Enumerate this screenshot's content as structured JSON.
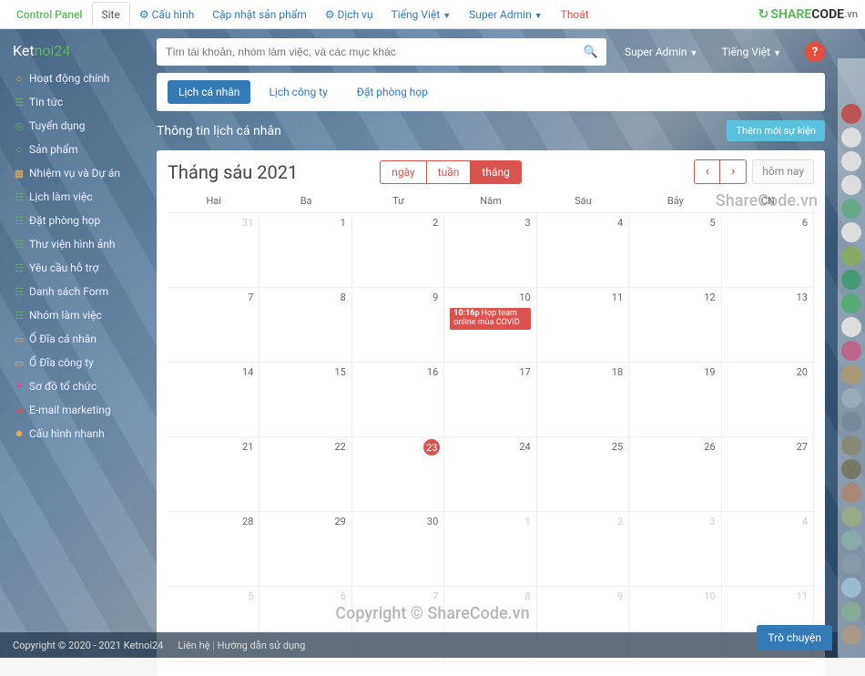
{
  "topnav": {
    "control_panel": "Control Panel",
    "site": "Site",
    "cauhinh": "Cấu hình",
    "capnhat": "Cập nhật sản phẩm",
    "dichvu": "Dịch vụ",
    "tiengviet": "Tiếng Việt",
    "superadmin": "Super Admin",
    "thoat": "Thoát"
  },
  "brand": {
    "ket": "Ket",
    "noi24": "noi24"
  },
  "sidebar": [
    {
      "icon": "○",
      "cls": "icn-orange",
      "label": "Hoạt động chính"
    },
    {
      "icon": "☰",
      "cls": "icn-green",
      "label": "Tin tức"
    },
    {
      "icon": "◎",
      "cls": "icn-green",
      "label": "Tuyển dụng"
    },
    {
      "icon": "○",
      "cls": "icn-green",
      "label": "Sản phẩm"
    },
    {
      "icon": "▦",
      "cls": "icn-orange",
      "label": "Nhiệm vụ và Dự án"
    },
    {
      "icon": "☷",
      "cls": "icn-green",
      "label": "Lịch làm việc"
    },
    {
      "icon": "☷",
      "cls": "icn-green",
      "label": "Đặt phòng họp"
    },
    {
      "icon": "☷",
      "cls": "icn-green",
      "label": "Thư viện hình ảnh"
    },
    {
      "icon": "☷",
      "cls": "icn-green",
      "label": "Yêu cầu hỗ trợ"
    },
    {
      "icon": "☷",
      "cls": "icn-green",
      "label": "Danh sách Form"
    },
    {
      "icon": "☷",
      "cls": "icn-green",
      "label": "Nhóm làm việc"
    },
    {
      "icon": "▭",
      "cls": "icn-orange",
      "label": "Ổ Đĩa cá nhân"
    },
    {
      "icon": "▭",
      "cls": "icn-orange",
      "label": "Ổ Đĩa công ty"
    },
    {
      "icon": "⚘",
      "cls": "icn-pink",
      "label": "Sơ đồ tổ chức"
    },
    {
      "icon": "✉",
      "cls": "icn-red",
      "label": "E-mail marketing"
    },
    {
      "icon": "✹",
      "cls": "icn-orange",
      "label": "Cấu hình nhanh"
    }
  ],
  "search": {
    "placeholder": "Tìm tài khoản, nhóm làm việc, và các mục khác"
  },
  "usermenu": {
    "superadmin": "Super Admin",
    "lang": "Tiếng Việt"
  },
  "tabs": {
    "t1": "Lịch cá nhân",
    "t2": "Lịch công ty",
    "t3": "Đặt phòng họp"
  },
  "page": {
    "title": "Thông tin lịch cá nhân",
    "addbtn": "Thêm mới sự kiện"
  },
  "cal": {
    "title": "Tháng sáu 2021",
    "view_day": "ngày",
    "view_week": "tuần",
    "view_month": "tháng",
    "today": "hôm nay",
    "dayheads": [
      "Hai",
      "Ba",
      "Tư",
      "Năm",
      "Sáu",
      "Bảy",
      "CN"
    ],
    "cells": [
      {
        "n": "31",
        "other": true
      },
      {
        "n": "1"
      },
      {
        "n": "2"
      },
      {
        "n": "3"
      },
      {
        "n": "4"
      },
      {
        "n": "5"
      },
      {
        "n": "6"
      },
      {
        "n": "7"
      },
      {
        "n": "8"
      },
      {
        "n": "9"
      },
      {
        "n": "10",
        "event": {
          "time": "10:16p",
          "title": "Họp team online mùa COVID"
        }
      },
      {
        "n": "11"
      },
      {
        "n": "12"
      },
      {
        "n": "13"
      },
      {
        "n": "14"
      },
      {
        "n": "15"
      },
      {
        "n": "16"
      },
      {
        "n": "17"
      },
      {
        "n": "18"
      },
      {
        "n": "19"
      },
      {
        "n": "20"
      },
      {
        "n": "21"
      },
      {
        "n": "22"
      },
      {
        "n": "23",
        "today": true
      },
      {
        "n": "24"
      },
      {
        "n": "25"
      },
      {
        "n": "26"
      },
      {
        "n": "27"
      },
      {
        "n": "28"
      },
      {
        "n": "29"
      },
      {
        "n": "30"
      },
      {
        "n": "1",
        "other": true
      },
      {
        "n": "2",
        "other": true
      },
      {
        "n": "3",
        "other": true
      },
      {
        "n": "4",
        "other": true
      },
      {
        "n": "5",
        "other": true
      },
      {
        "n": "6",
        "other": true
      },
      {
        "n": "7",
        "other": true
      },
      {
        "n": "8",
        "other": true
      },
      {
        "n": "9",
        "other": true
      },
      {
        "n": "10",
        "other": true
      },
      {
        "n": "11",
        "other": true
      }
    ]
  },
  "watermark1": "ShareCode.vn",
  "watermark2": "Copyright © ShareCode.vn",
  "logo": {
    "share": "SHARE",
    "code": "CODE",
    "vn": ".vn"
  },
  "footer": {
    "copy": "Copyright © 2020 - 2021 Ketnoi24",
    "lienhe": "Liên hệ",
    "hd": "Hướng dẫn sử dụng"
  },
  "chat": "Trò chuyện",
  "avatars_count": 23,
  "avatar_colors": [
    "#b55",
    "#ddd",
    "#ddd",
    "#ddd",
    "#6a8",
    "#ddd",
    "#8a6",
    "#497",
    "#5a7",
    "#ddd",
    "#b68",
    "#a97",
    "#9ab",
    "#789",
    "#887",
    "#776",
    "#a87",
    "#9a8",
    "#8aa",
    "#89a",
    "#9bc",
    "#8a9",
    "#a98"
  ]
}
